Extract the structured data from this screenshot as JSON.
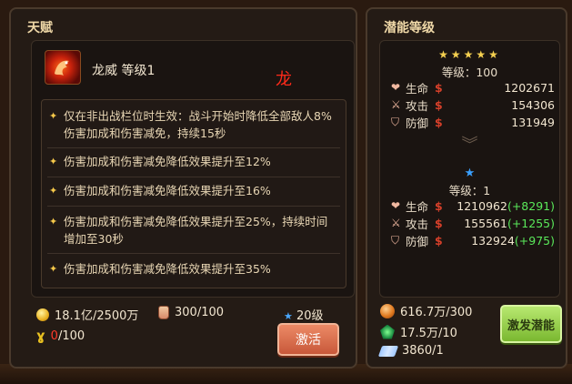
{
  "talent_panel": {
    "title": "天赋",
    "talent_name": "龙威 等级1",
    "talent_tag": "龙",
    "effects": [
      "仅在非出战栏位时生效：战斗开始时降低全部敌人8%伤害加成和伤害减免，持续15秒",
      "伤害加成和伤害减免降低效果提升至12%",
      "伤害加成和伤害减免降低效果提升至16%",
      "伤害加成和伤害减免降低效果提升至25%，持续时间增加至30秒",
      "伤害加成和伤害减免降低效果提升至35%"
    ],
    "gold_cost": "18.1亿/2500万",
    "jar_cost": "300/100",
    "v_current": "0",
    "v_total": "/100",
    "level_required": "20级",
    "activate_label": "激活"
  },
  "potential_panel": {
    "title": "潜能等级",
    "top_stars": "★★★★★",
    "top_level": "等级：100",
    "top_stats": [
      {
        "icon": "heart-icon",
        "label": "生命",
        "value": "1202671"
      },
      {
        "icon": "sword-icon",
        "label": "攻击",
        "value": "154306"
      },
      {
        "icon": "shield-icon",
        "label": "防御",
        "value": "131949"
      }
    ],
    "bottom_level": "等级：1",
    "bottom_stats": [
      {
        "icon": "heart-icon",
        "label": "生命",
        "value": "1210962",
        "bonus": "(+8291)"
      },
      {
        "icon": "sword-icon",
        "label": "攻击",
        "value": "155561",
        "bonus": "(+1255)"
      },
      {
        "icon": "shield-icon",
        "label": "防御",
        "value": "132924",
        "bonus": "(+975)"
      }
    ],
    "res_orb": "616.7万/300",
    "res_gem": "17.5万/10",
    "res_scroll": "3860/1",
    "burst_label": "激发潜能"
  },
  "colors": {
    "accent_gold": "#f5d050",
    "bonus_green": "#5ae85a",
    "warning_red": "#ff3a2a",
    "activate_orange": "#d8603e",
    "burst_green": "#8ac83a"
  }
}
